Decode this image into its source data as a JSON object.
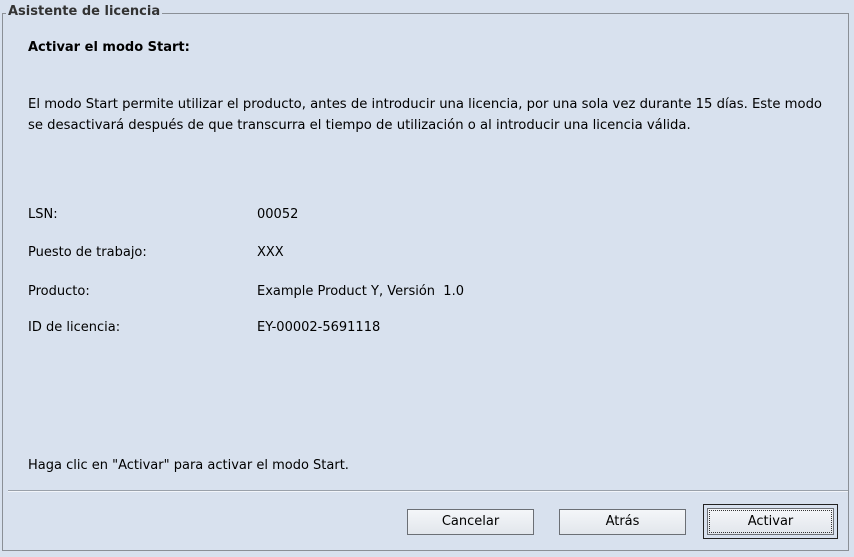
{
  "wizard": {
    "title": "Asistente de licencia",
    "heading": "Activar el modo Start:",
    "description": "El modo Start permite utilizar el producto, antes de introducir una licencia, por una sola vez durante 15 días. Este modo se desactivará después de que transcurra el tiempo de utilización o al introducir una licencia válida.",
    "info": {
      "lsn": {
        "label": "LSN:",
        "value": "00052"
      },
      "workstation": {
        "label": "Puesto de trabajo:",
        "value": "XXX"
      },
      "product": {
        "label": "Producto:",
        "value": "Example Product Y, Versión  1.0"
      },
      "license_id": {
        "label": "ID de licencia:",
        "value": "EY-00002-5691118"
      }
    },
    "hint": "Haga clic en \"Activar\" para activar el modo Start."
  },
  "buttons": {
    "cancel": "Cancelar",
    "back": "Atrás",
    "activate": "Activar"
  }
}
